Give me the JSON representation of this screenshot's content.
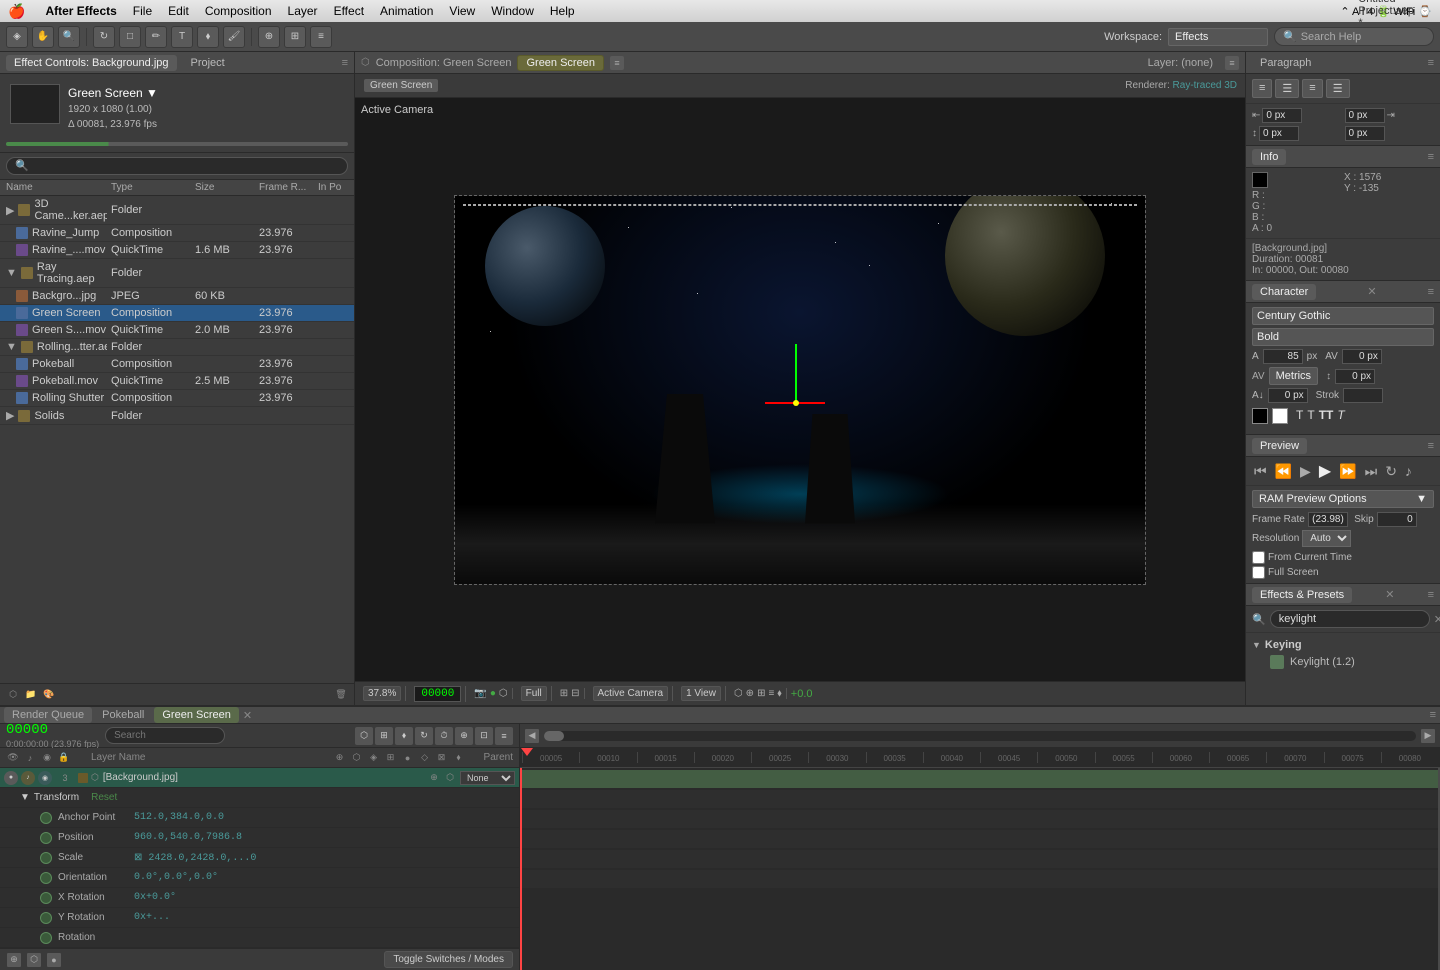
{
  "menubar": {
    "apple": "⌘",
    "app_name": "After Effects",
    "items": [
      "File",
      "Edit",
      "Composition",
      "Layer",
      "Effect",
      "Animation",
      "View",
      "Window",
      "Help"
    ],
    "title": "Untitled Project.aep *",
    "right_info": "⌃ A l 4"
  },
  "toolbar": {
    "workspace_label": "Workspace:",
    "workspace_value": "Effects",
    "search_placeholder": "Search Help"
  },
  "left_panel": {
    "tabs": [
      "Effect Controls: Background.jpg",
      "Project"
    ],
    "effect_controls": {
      "name": "Green Screen ▼",
      "dimensions": "1920 x 1080 (1.00)",
      "timecode": "Δ 00081, 23.976 fps"
    },
    "project_search_placeholder": "🔍",
    "table_headers": [
      "Name",
      "Type",
      "Size",
      "Frame R...",
      "In Po"
    ],
    "items": [
      {
        "indent": 0,
        "type": "folder",
        "name": "3D Came...ker.aep",
        "item_type": "Folder",
        "size": "",
        "fps": "",
        "in": ""
      },
      {
        "indent": 1,
        "type": "comp",
        "name": "Ravine_Jump",
        "item_type": "Composition",
        "size": "",
        "fps": "23.976",
        "in": ""
      },
      {
        "indent": 1,
        "type": "mov",
        "name": "Ravine_....mov",
        "item_type": "QuickTime",
        "size": "1.6 MB",
        "fps": "23.976",
        "in": ""
      },
      {
        "indent": 0,
        "type": "folder",
        "name": "Ray Tracing.aep",
        "item_type": "Folder",
        "size": "",
        "fps": "",
        "in": ""
      },
      {
        "indent": 1,
        "type": "img",
        "name": "Backgro...jpg",
        "item_type": "JPEG",
        "size": "60 KB",
        "fps": "",
        "in": ""
      },
      {
        "indent": 1,
        "type": "comp",
        "name": "Green Screen",
        "item_type": "Composition",
        "size": "",
        "fps": "23.976",
        "in": "",
        "selected": true
      },
      {
        "indent": 1,
        "type": "mov",
        "name": "Green S....mov",
        "item_type": "QuickTime",
        "size": "2.0 MB",
        "fps": "23.976",
        "in": ""
      },
      {
        "indent": 0,
        "type": "folder",
        "name": "Rolling...tter.aep",
        "item_type": "Folder",
        "size": "",
        "fps": "",
        "in": ""
      },
      {
        "indent": 1,
        "type": "comp",
        "name": "Pokeball",
        "item_type": "Composition",
        "size": "",
        "fps": "23.976",
        "in": ""
      },
      {
        "indent": 1,
        "type": "mov",
        "name": "Pokeball.mov",
        "item_type": "QuickTime",
        "size": "2.5 MB",
        "fps": "23.976",
        "in": ""
      },
      {
        "indent": 1,
        "type": "comp",
        "name": "Rolling Shutter",
        "item_type": "Composition",
        "size": "",
        "fps": "23.976",
        "in": ""
      },
      {
        "indent": 0,
        "type": "folder",
        "name": "Solids",
        "item_type": "Folder",
        "size": "",
        "fps": "",
        "in": ""
      }
    ]
  },
  "composition": {
    "tab_label": "Green Screen",
    "comp_header": "Composition: Green Screen",
    "layer_display": "Layer: (none)",
    "active_camera": "Active Camera",
    "renderer": "Renderer:",
    "renderer_value": "Ray-traced 3D",
    "timecode": "00000",
    "zoom": "37.8%",
    "quality": "Full",
    "camera_view": "Active Camera",
    "num_views": "1 View",
    "green_plus": "+0.0"
  },
  "right_panel": {
    "character": {
      "tab": "Character",
      "font": "Century Gothic",
      "weight": "Bold",
      "size_label": "px",
      "size_value": "85",
      "metrics_label": "Metrics",
      "offset_labels": [
        "0 px",
        "0 px"
      ],
      "stroke_label": "Strok",
      "format_btns": [
        "T",
        "T",
        "TT",
        "T"
      ]
    },
    "info": {
      "tab": "Info",
      "r_label": "R :",
      "g_label": "G :",
      "b_label": "B :",
      "a_label": "A : 0",
      "x_label": "X : 1576",
      "y_label": "Y : -135",
      "file_name": "[Background.jpg]",
      "duration": "Duration: 00081",
      "in_out": "In: 00000, Out: 00080"
    },
    "preview": {
      "tab": "Preview",
      "ram_preview": "RAM Preview Options",
      "frame_rate_label": "Frame Rate",
      "frame_rate_value": "(23.98)",
      "skip_label": "Skip",
      "skip_value": "0",
      "resolution_label": "Resolution",
      "resolution_value": "Auto",
      "from_current": "From Current Time",
      "full_screen": "Full Screen"
    },
    "effects_presets": {
      "tab": "Effects & Presets",
      "search_placeholder": "keylight",
      "groups": [
        {
          "name": "Keying",
          "items": [
            "Keylight (1.2)"
          ]
        }
      ]
    }
  },
  "timeline": {
    "tabs": [
      "Render Queue",
      "Pokeball",
      "Green Screen"
    ],
    "active_tab": "Green Screen",
    "timecode_main": "00000",
    "timecode_sub": "0:00:00:00 (23.976 fps)",
    "ruler_marks": [
      "00005",
      "00010",
      "00015",
      "00020",
      "00025",
      "00030",
      "00035",
      "00040",
      "00045",
      "00050",
      "00055",
      "00060",
      "00065",
      "00070",
      "00075",
      "00080"
    ],
    "layers": [
      {
        "num": 3,
        "name": "[Background.jpg]",
        "parent": "None",
        "selected": true
      }
    ],
    "transform": {
      "header": "Transform",
      "reset_label": "Reset",
      "properties": [
        {
          "name": "Anchor Point",
          "value": "512.0,384.0,0.0"
        },
        {
          "name": "Position",
          "value": "960.0,540.0,7986.8"
        },
        {
          "name": "Scale",
          "value": "⊠ 2428.0,2428.0,...0"
        },
        {
          "name": "Orientation",
          "value": "0.0°,0.0°,0.0°"
        },
        {
          "name": "X Rotation",
          "value": "0x+0.0°"
        },
        {
          "name": "Y Rotation",
          "value": "0x+..."
        }
      ]
    },
    "bottom_label": "Toggle Switches / Modes",
    "rotation_label": "Rotation"
  }
}
